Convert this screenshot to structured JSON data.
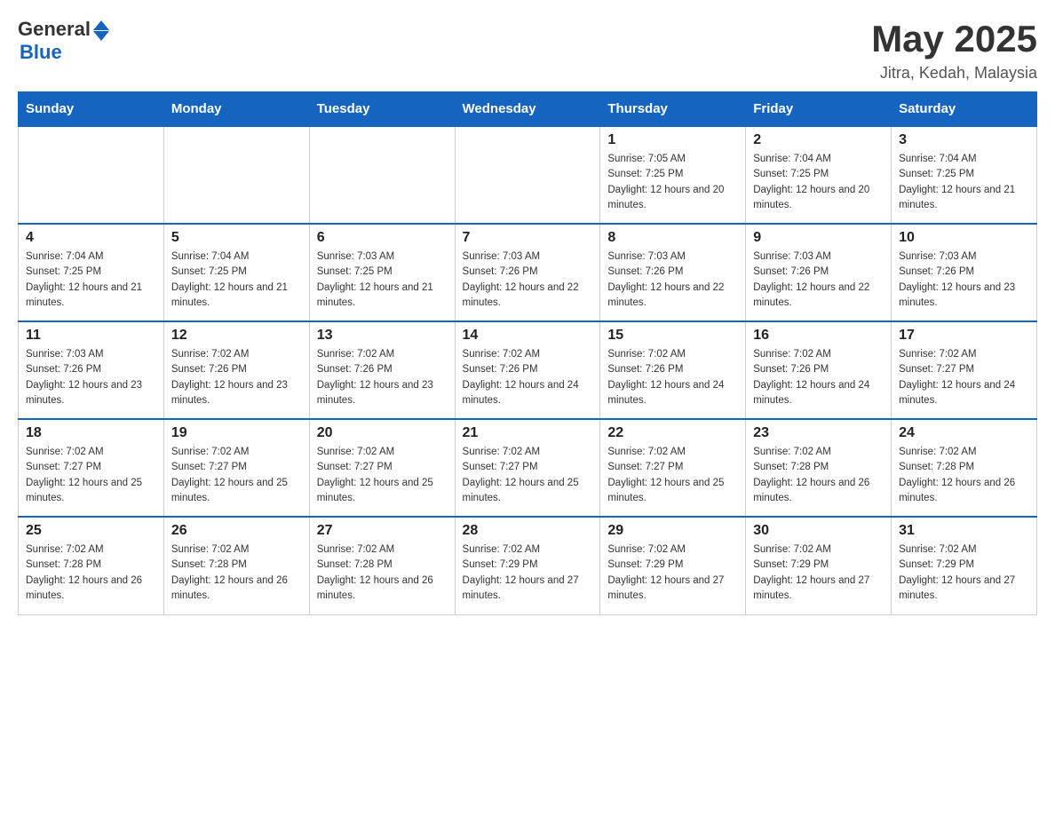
{
  "header": {
    "logo": {
      "text_general": "General",
      "text_blue": "Blue",
      "arrow": "▲"
    },
    "title": "May 2025",
    "location": "Jitra, Kedah, Malaysia"
  },
  "days_of_week": [
    "Sunday",
    "Monday",
    "Tuesday",
    "Wednesday",
    "Thursday",
    "Friday",
    "Saturday"
  ],
  "weeks": [
    [
      {
        "day": "",
        "sunrise": "",
        "sunset": "",
        "daylight": ""
      },
      {
        "day": "",
        "sunrise": "",
        "sunset": "",
        "daylight": ""
      },
      {
        "day": "",
        "sunrise": "",
        "sunset": "",
        "daylight": ""
      },
      {
        "day": "",
        "sunrise": "",
        "sunset": "",
        "daylight": ""
      },
      {
        "day": "1",
        "sunrise": "Sunrise: 7:05 AM",
        "sunset": "Sunset: 7:25 PM",
        "daylight": "Daylight: 12 hours and 20 minutes."
      },
      {
        "day": "2",
        "sunrise": "Sunrise: 7:04 AM",
        "sunset": "Sunset: 7:25 PM",
        "daylight": "Daylight: 12 hours and 20 minutes."
      },
      {
        "day": "3",
        "sunrise": "Sunrise: 7:04 AM",
        "sunset": "Sunset: 7:25 PM",
        "daylight": "Daylight: 12 hours and 21 minutes."
      }
    ],
    [
      {
        "day": "4",
        "sunrise": "Sunrise: 7:04 AM",
        "sunset": "Sunset: 7:25 PM",
        "daylight": "Daylight: 12 hours and 21 minutes."
      },
      {
        "day": "5",
        "sunrise": "Sunrise: 7:04 AM",
        "sunset": "Sunset: 7:25 PM",
        "daylight": "Daylight: 12 hours and 21 minutes."
      },
      {
        "day": "6",
        "sunrise": "Sunrise: 7:03 AM",
        "sunset": "Sunset: 7:25 PM",
        "daylight": "Daylight: 12 hours and 21 minutes."
      },
      {
        "day": "7",
        "sunrise": "Sunrise: 7:03 AM",
        "sunset": "Sunset: 7:26 PM",
        "daylight": "Daylight: 12 hours and 22 minutes."
      },
      {
        "day": "8",
        "sunrise": "Sunrise: 7:03 AM",
        "sunset": "Sunset: 7:26 PM",
        "daylight": "Daylight: 12 hours and 22 minutes."
      },
      {
        "day": "9",
        "sunrise": "Sunrise: 7:03 AM",
        "sunset": "Sunset: 7:26 PM",
        "daylight": "Daylight: 12 hours and 22 minutes."
      },
      {
        "day": "10",
        "sunrise": "Sunrise: 7:03 AM",
        "sunset": "Sunset: 7:26 PM",
        "daylight": "Daylight: 12 hours and 23 minutes."
      }
    ],
    [
      {
        "day": "11",
        "sunrise": "Sunrise: 7:03 AM",
        "sunset": "Sunset: 7:26 PM",
        "daylight": "Daylight: 12 hours and 23 minutes."
      },
      {
        "day": "12",
        "sunrise": "Sunrise: 7:02 AM",
        "sunset": "Sunset: 7:26 PM",
        "daylight": "Daylight: 12 hours and 23 minutes."
      },
      {
        "day": "13",
        "sunrise": "Sunrise: 7:02 AM",
        "sunset": "Sunset: 7:26 PM",
        "daylight": "Daylight: 12 hours and 23 minutes."
      },
      {
        "day": "14",
        "sunrise": "Sunrise: 7:02 AM",
        "sunset": "Sunset: 7:26 PM",
        "daylight": "Daylight: 12 hours and 24 minutes."
      },
      {
        "day": "15",
        "sunrise": "Sunrise: 7:02 AM",
        "sunset": "Sunset: 7:26 PM",
        "daylight": "Daylight: 12 hours and 24 minutes."
      },
      {
        "day": "16",
        "sunrise": "Sunrise: 7:02 AM",
        "sunset": "Sunset: 7:26 PM",
        "daylight": "Daylight: 12 hours and 24 minutes."
      },
      {
        "day": "17",
        "sunrise": "Sunrise: 7:02 AM",
        "sunset": "Sunset: 7:27 PM",
        "daylight": "Daylight: 12 hours and 24 minutes."
      }
    ],
    [
      {
        "day": "18",
        "sunrise": "Sunrise: 7:02 AM",
        "sunset": "Sunset: 7:27 PM",
        "daylight": "Daylight: 12 hours and 25 minutes."
      },
      {
        "day": "19",
        "sunrise": "Sunrise: 7:02 AM",
        "sunset": "Sunset: 7:27 PM",
        "daylight": "Daylight: 12 hours and 25 minutes."
      },
      {
        "day": "20",
        "sunrise": "Sunrise: 7:02 AM",
        "sunset": "Sunset: 7:27 PM",
        "daylight": "Daylight: 12 hours and 25 minutes."
      },
      {
        "day": "21",
        "sunrise": "Sunrise: 7:02 AM",
        "sunset": "Sunset: 7:27 PM",
        "daylight": "Daylight: 12 hours and 25 minutes."
      },
      {
        "day": "22",
        "sunrise": "Sunrise: 7:02 AM",
        "sunset": "Sunset: 7:27 PM",
        "daylight": "Daylight: 12 hours and 25 minutes."
      },
      {
        "day": "23",
        "sunrise": "Sunrise: 7:02 AM",
        "sunset": "Sunset: 7:28 PM",
        "daylight": "Daylight: 12 hours and 26 minutes."
      },
      {
        "day": "24",
        "sunrise": "Sunrise: 7:02 AM",
        "sunset": "Sunset: 7:28 PM",
        "daylight": "Daylight: 12 hours and 26 minutes."
      }
    ],
    [
      {
        "day": "25",
        "sunrise": "Sunrise: 7:02 AM",
        "sunset": "Sunset: 7:28 PM",
        "daylight": "Daylight: 12 hours and 26 minutes."
      },
      {
        "day": "26",
        "sunrise": "Sunrise: 7:02 AM",
        "sunset": "Sunset: 7:28 PM",
        "daylight": "Daylight: 12 hours and 26 minutes."
      },
      {
        "day": "27",
        "sunrise": "Sunrise: 7:02 AM",
        "sunset": "Sunset: 7:28 PM",
        "daylight": "Daylight: 12 hours and 26 minutes."
      },
      {
        "day": "28",
        "sunrise": "Sunrise: 7:02 AM",
        "sunset": "Sunset: 7:29 PM",
        "daylight": "Daylight: 12 hours and 27 minutes."
      },
      {
        "day": "29",
        "sunrise": "Sunrise: 7:02 AM",
        "sunset": "Sunset: 7:29 PM",
        "daylight": "Daylight: 12 hours and 27 minutes."
      },
      {
        "day": "30",
        "sunrise": "Sunrise: 7:02 AM",
        "sunset": "Sunset: 7:29 PM",
        "daylight": "Daylight: 12 hours and 27 minutes."
      },
      {
        "day": "31",
        "sunrise": "Sunrise: 7:02 AM",
        "sunset": "Sunset: 7:29 PM",
        "daylight": "Daylight: 12 hours and 27 minutes."
      }
    ]
  ]
}
